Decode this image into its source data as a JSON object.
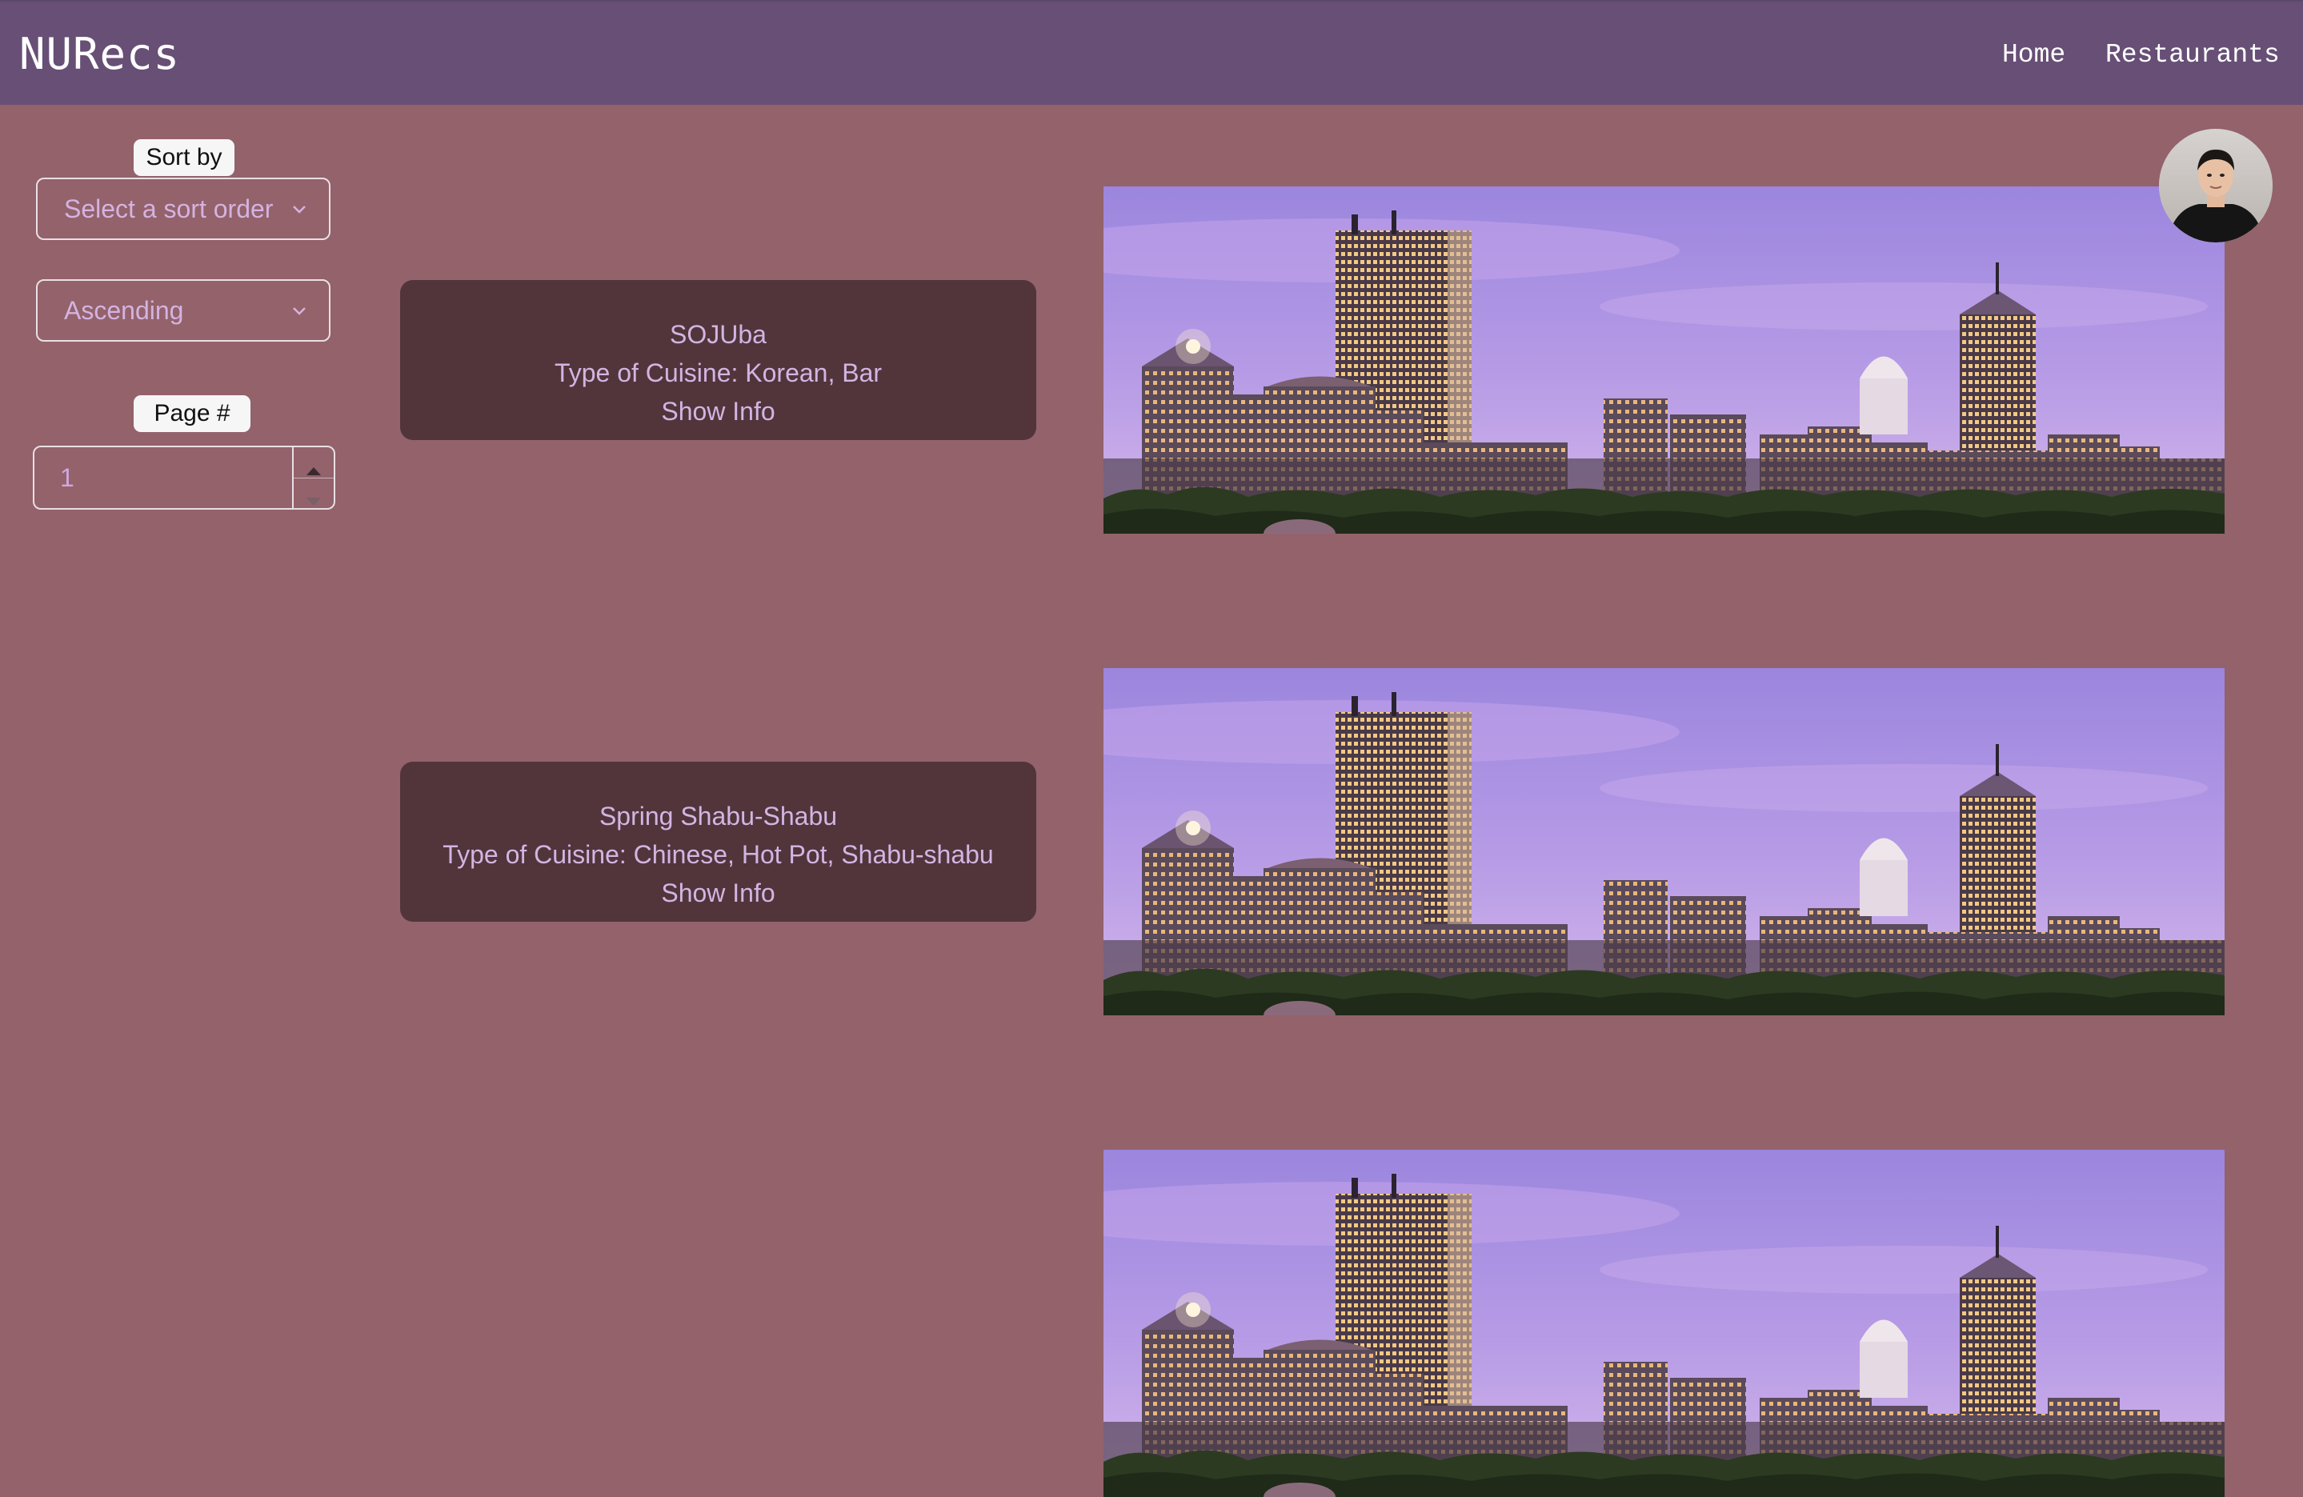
{
  "navbar": {
    "brand": "NURecs",
    "links": [
      {
        "label": "Home"
      },
      {
        "label": "Restaurants"
      }
    ]
  },
  "filters": {
    "sort_label": "Sort by",
    "sort_placeholder": "Select a sort order",
    "order_value": "Ascending",
    "page_label": "Page #",
    "page_value": "1"
  },
  "restaurants": [
    {
      "name": "SOJUba",
      "cuisine": "Type of Cuisine: Korean, Bar",
      "action": "Show Info"
    },
    {
      "name": "Spring Shabu-Shabu",
      "cuisine": "Type of Cuisine: Chinese, Hot Pot, Shabu-shabu",
      "action": "Show Info"
    }
  ],
  "colors": {
    "page_bg": "#93626b",
    "navbar_bg": "#674f76",
    "card_bg": "#51353b",
    "card_text": "#d2b5e2",
    "select_text": "#d4b3e0"
  },
  "icons": {
    "select_chevron": "chevron-down-icon",
    "stepper_up": "triangle-up-icon",
    "stepper_down": "triangle-down-icon"
  }
}
